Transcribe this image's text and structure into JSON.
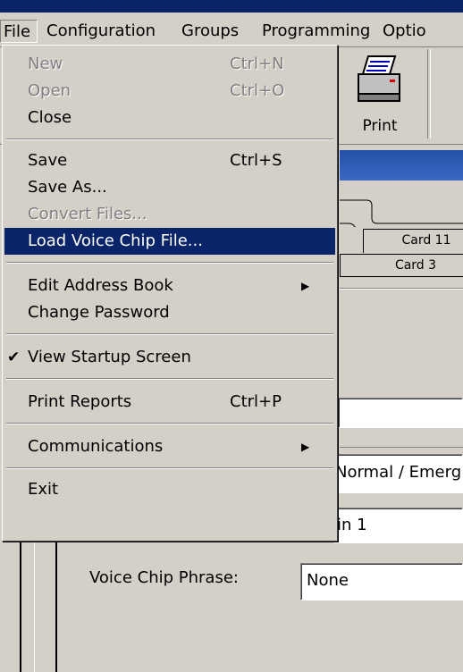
{
  "menubar": {
    "items": [
      "File",
      "Configuration",
      "Groups",
      "Programming",
      "Optio"
    ]
  },
  "toolbar": {
    "print_label": "Print"
  },
  "tabs": {
    "card_11": "Card 11",
    "card_3": "Card 3"
  },
  "mode_value": "Normal / Emerg",
  "chain_value": "in 1",
  "voice_chip": {
    "label": "Voice Chip Phrase:",
    "value": "None"
  },
  "file_menu": {
    "new": {
      "label": "New",
      "shortcut": "Ctrl+N"
    },
    "open": {
      "label": "Open",
      "shortcut": "Ctrl+O"
    },
    "close": {
      "label": "Close"
    },
    "save": {
      "label": "Save",
      "shortcut": "Ctrl+S"
    },
    "save_as": {
      "label": "Save As..."
    },
    "convert_files": {
      "label": "Convert Files..."
    },
    "load_voice_chip": {
      "label": "Load Voice Chip File..."
    },
    "edit_address_book": {
      "label": "Edit Address Book"
    },
    "change_password": {
      "label": "Change Password"
    },
    "view_startup": {
      "label": "View Startup Screen",
      "check": "✔"
    },
    "print_reports": {
      "label": "Print Reports",
      "shortcut": "Ctrl+P"
    },
    "communications": {
      "label": "Communications"
    },
    "exit": {
      "label": "Exit"
    }
  },
  "icons": {
    "submenu": "arrow-right-icon",
    "check": "checkmark-icon",
    "printer": "printer-icon"
  },
  "colors": {
    "highlight": "#0a246a",
    "face": "#d4d0c8",
    "header_blue": "#2550a8"
  }
}
